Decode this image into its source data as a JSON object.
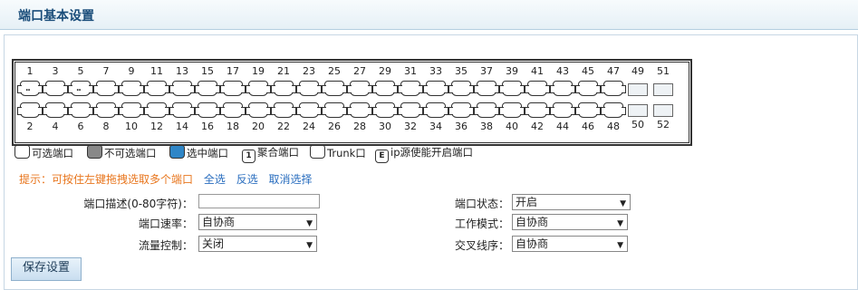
{
  "header": {
    "title": "端口基本设置"
  },
  "ports": {
    "top": [
      "1",
      "3",
      "5",
      "7",
      "9",
      "11",
      "13",
      "15",
      "17",
      "19",
      "21",
      "23",
      "25",
      "27",
      "29",
      "31",
      "33",
      "35",
      "37",
      "39",
      "41",
      "43",
      "45",
      "47"
    ],
    "bottom": [
      "2",
      "4",
      "6",
      "8",
      "10",
      "12",
      "14",
      "16",
      "18",
      "20",
      "22",
      "24",
      "26",
      "28",
      "30",
      "32",
      "34",
      "36",
      "38",
      "40",
      "42",
      "44",
      "46",
      "48"
    ],
    "fiber_top": [
      "49",
      "51"
    ],
    "fiber_bottom": [
      "50",
      "52"
    ],
    "dotted_ports": [
      "1",
      "5"
    ]
  },
  "legend": {
    "selectable": "可选端口",
    "unselectable": "不可选端口",
    "selected": "选中端口",
    "aggregate_num": "1",
    "aggregate": "聚合端口",
    "trunk": "Trunk口",
    "ipsource_letter": "E",
    "ipsource": "ip源使能开启端口"
  },
  "tip": {
    "hint": "提示：可按住左键拖拽选取多个端口",
    "select_all": "全选",
    "invert": "反选",
    "cancel": "取消选择"
  },
  "form": {
    "desc_label": "端口描述(0-80字符)：",
    "desc_value": "",
    "state_label": "端口状态：",
    "state_value": "开启",
    "speed_label": "端口速率：",
    "speed_value": "自协商",
    "mode_label": "工作模式：",
    "mode_value": "自协商",
    "flow_label": "流量控制：",
    "flow_value": "关闭",
    "cross_label": "交叉线序：",
    "cross_value": "自协商"
  },
  "save_label": "保存设置"
}
